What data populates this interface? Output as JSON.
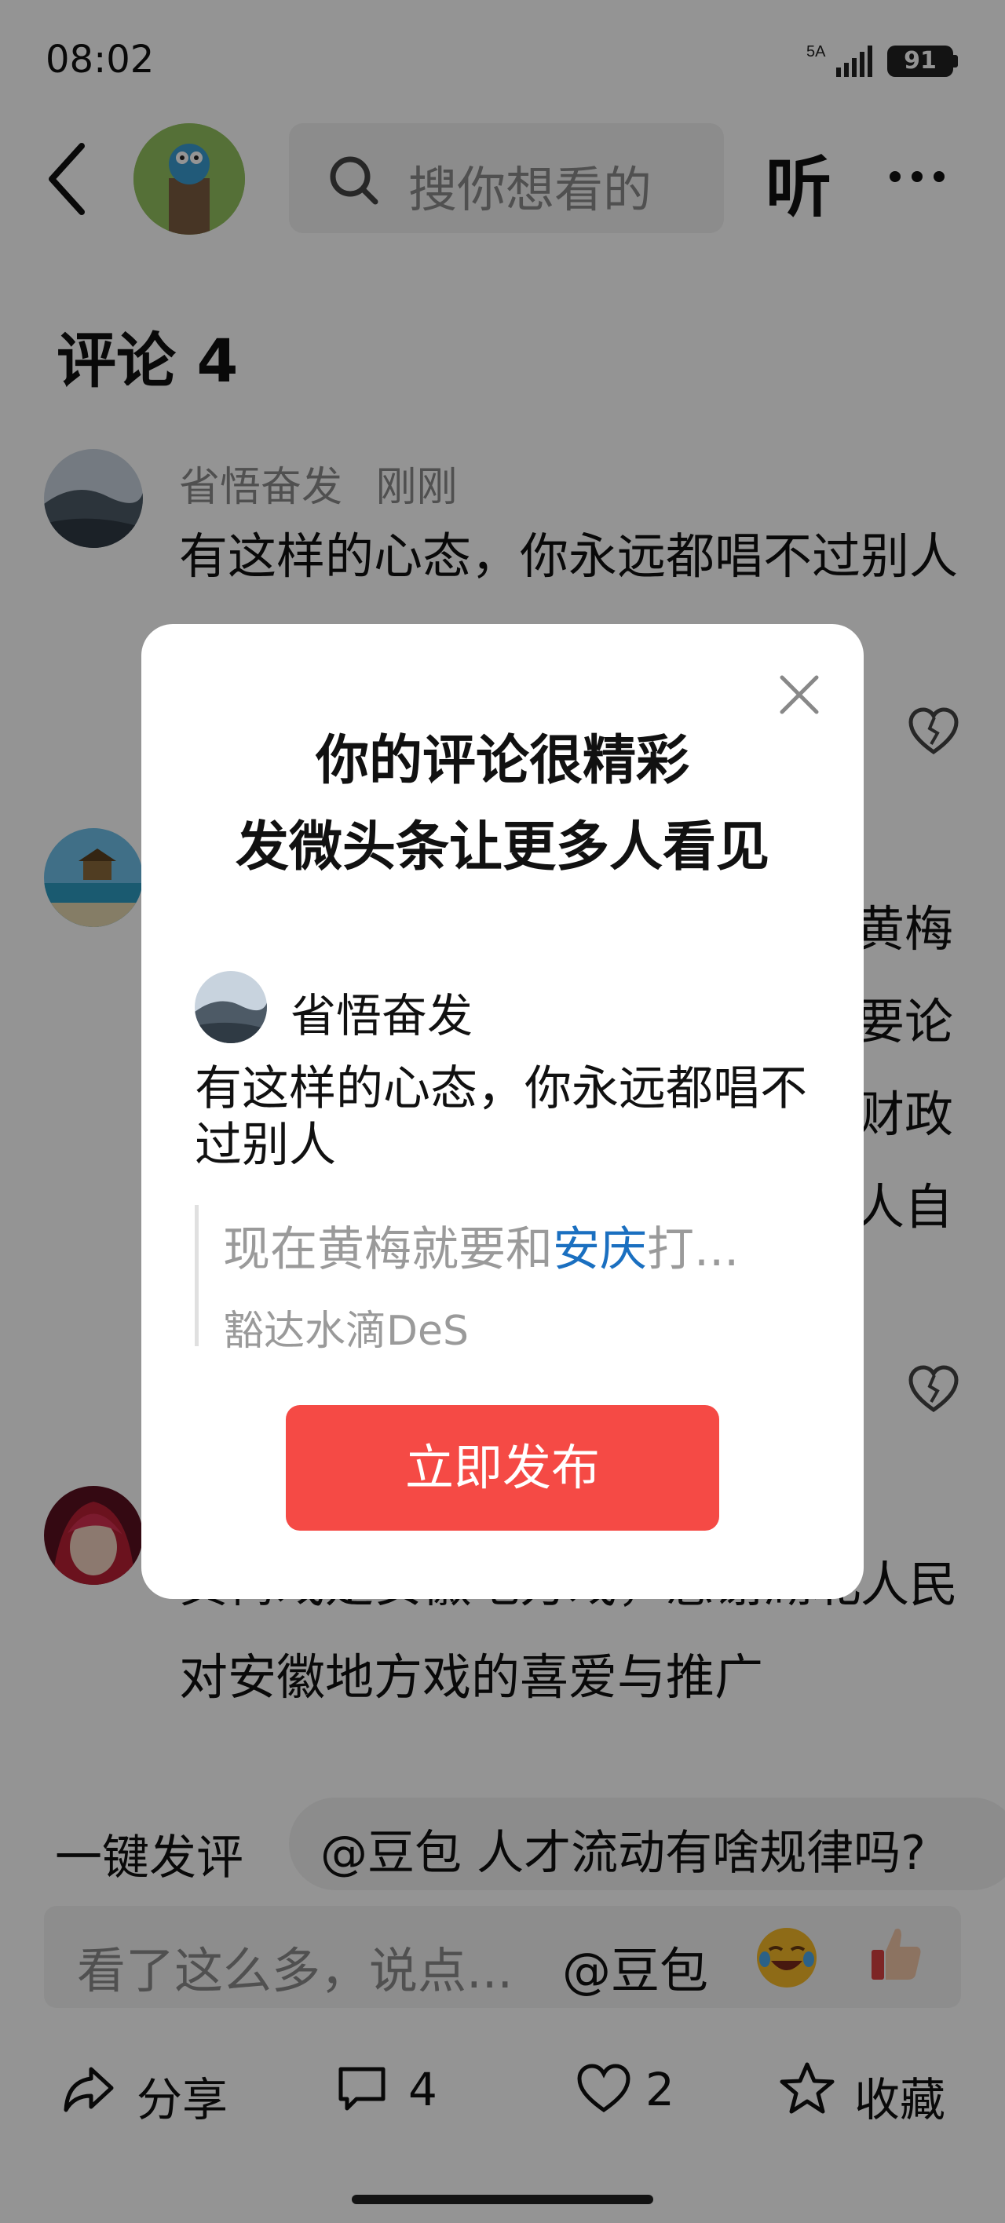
{
  "status_bar": {
    "time": "08:02",
    "network": "5A",
    "battery": "91"
  },
  "header": {
    "search_placeholder": "搜你想看的",
    "listen_label": "听"
  },
  "comments": {
    "title": "评论 4",
    "items": [
      {
        "author": "省悟奋发",
        "time": "刚刚",
        "text": "有这样的心态，你永远都唱不过别人"
      },
      {
        "author": "",
        "time": "",
        "text_fragments": [
          "黄梅",
          "要论",
          "财政",
          "人自"
        ]
      },
      {
        "author": "",
        "time": "",
        "text": "黄梅戏是安徽地方戏，感谢湖北人民对安徽地方戏的喜爱与推广"
      }
    ]
  },
  "quick_comment": {
    "label": "一键发评",
    "suggestion": "@豆包 人才流动有啥规律吗?"
  },
  "input_bar": {
    "placeholder": "看了这么多，说点...",
    "at_label": "@豆包"
  },
  "actions": {
    "share": "分享",
    "comments_count": "4",
    "likes_count": "2",
    "favorite": "收藏"
  },
  "modal": {
    "title_line1": "你的评论很精彩",
    "title_line2": "发微头条让更多人看见",
    "author": "省悟奋发",
    "comment": "有这样的心态，你永远都唱不过别人",
    "quote_prefix": "现在黄梅就要和",
    "quote_link": "安庆",
    "quote_suffix": "打...",
    "quote_author": "豁达水滴DeS",
    "publish_label": "立即发布"
  },
  "colors": {
    "accent": "#f54a45",
    "link": "#1a6fc0"
  }
}
